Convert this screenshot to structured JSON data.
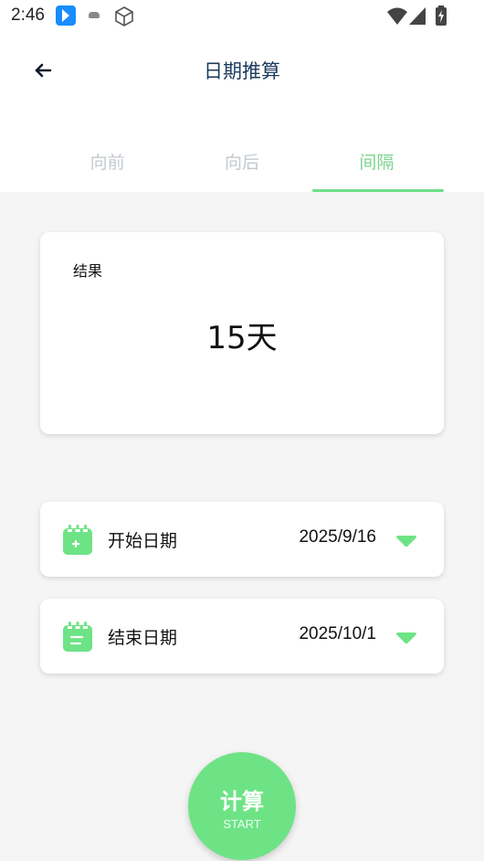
{
  "status_bar": {
    "time": "2:46",
    "icons": [
      "app-notification-icon",
      "cloud-icon",
      "box-icon",
      "wifi-icon",
      "signal-icon",
      "battery-icon"
    ]
  },
  "header": {
    "title": "日期推算",
    "back_icon": "arrow-left-icon"
  },
  "tabs": [
    {
      "label": "向前",
      "active": false
    },
    {
      "label": "向后",
      "active": false
    },
    {
      "label": "间隔",
      "active": true
    }
  ],
  "result": {
    "label": "结果",
    "value": "15天"
  },
  "dates": {
    "start": {
      "label": "开始日期",
      "value": "2025/9/16",
      "icon": "calendar-plus-icon"
    },
    "end": {
      "label": "结束日期",
      "value": "2025/10/1",
      "icon": "calendar-minus-icon"
    }
  },
  "fab": {
    "title": "计算",
    "subtitle": "START"
  },
  "colors": {
    "accent": "#6ee386",
    "tab_active": "#7ad38c",
    "tab_inactive": "#c3c9cf",
    "title": "#1b3a5c",
    "background": "#f5f5f5"
  }
}
